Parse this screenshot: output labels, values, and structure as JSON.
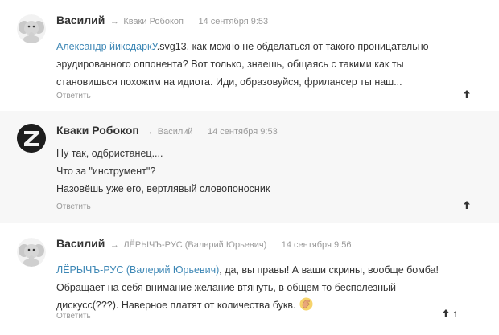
{
  "comments": [
    {
      "author": "Василий",
      "arrow": "→",
      "reply_to": "Кваки Робокоп",
      "date": "14 сентября 9:53",
      "avatar_icon": "elephant-avatar",
      "mention": "Александр йиксдаркУ",
      "lines": [
        ".svg13, как можно не обделаться от такого проницательно",
        "эрудированного оппонента? Вот только, знаешь, общаясь с такими как ты",
        "становишься похожим на идиота. Иди, образовуйся, фрилансер ты наш..."
      ],
      "reply_label": "Ответить",
      "vote_icon": "upvote-arrow-icon",
      "votes": ""
    },
    {
      "author": "Кваки Робокоп",
      "arrow": "→",
      "reply_to": "Василий",
      "date": "14 сентября 9:53",
      "avatar_icon": "letter-z-avatar",
      "lines": [
        "Ну так, одбристанец....",
        "Что за \"инструмент\"?",
        "Назовёшь уже его, вертлявый словопоносник"
      ],
      "reply_label": "Ответить",
      "vote_icon": "upvote-arrow-icon",
      "votes": ""
    },
    {
      "author": "Василий",
      "arrow": "→",
      "reply_to": "ЛЁРЫЧЪ-РУС (Валерий Юрьевич)",
      "date": "14 сентября 9:56",
      "avatar_icon": "elephant-avatar",
      "mention": "ЛЁРЫЧЪ-РУС (Валерий Юрьевич)",
      "lines": [
        ", да, вы правы! А ваши скрины, вообще бомба!",
        "Обращает на себя внимание желание втянуть, в общем то бесполезный",
        "дискусс(???). Наверное платят от количества букв."
      ],
      "emoji_icon": "clapping-hand-emoji",
      "reply_label": "Ответить",
      "vote_icon": "upvote-arrow-icon",
      "votes": "1"
    }
  ],
  "colors": {
    "mention": "#3d87b5",
    "meta": "#9a9a9a",
    "highlight_bg": "#f7f7f7"
  }
}
